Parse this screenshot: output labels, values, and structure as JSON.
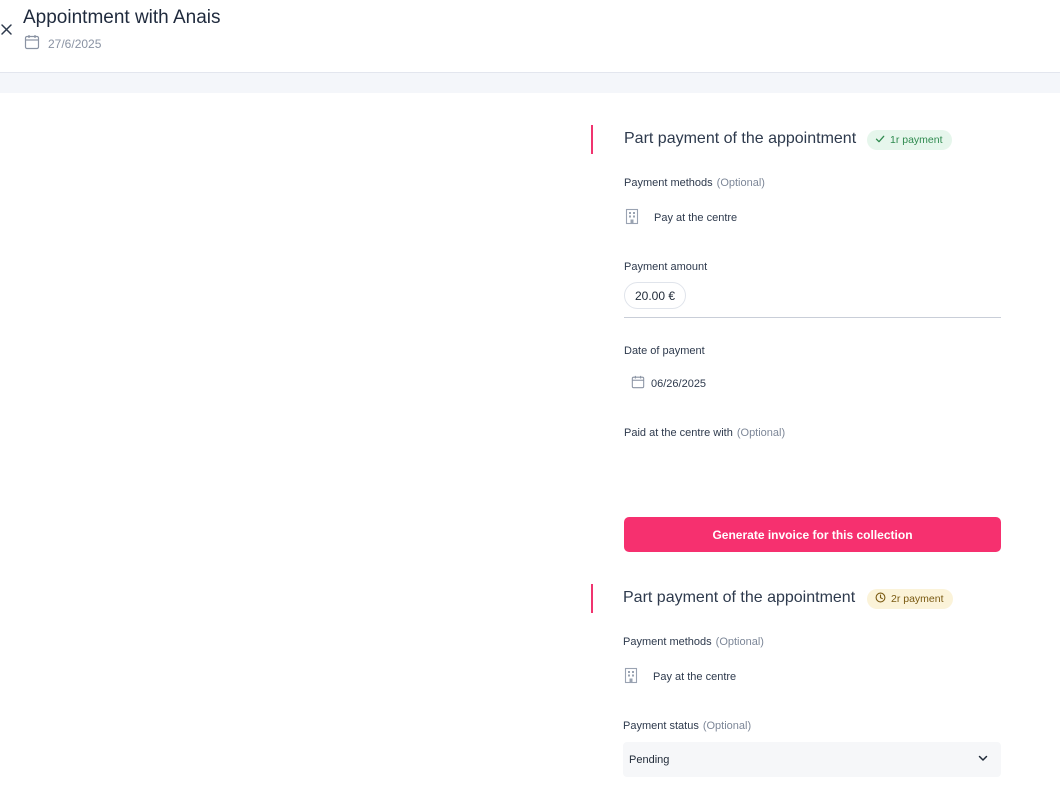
{
  "header": {
    "title": "Appointment with Anais",
    "date": "27/6/2025"
  },
  "payments": [
    {
      "title": "Part payment of the appointment",
      "badge": "1r payment",
      "badge_status": "paid",
      "methods_label": "Payment methods",
      "optional": "(Optional)",
      "method": "Pay at the centre",
      "amount_label": "Payment amount",
      "amount": "20.00 €",
      "date_label": "Date of payment",
      "date": "06/26/2025",
      "paid_with_label": "Paid at the centre with",
      "button_label": "Generate invoice for this collection"
    },
    {
      "title": "Part payment of the appointment",
      "badge": "2r payment",
      "badge_status": "pending",
      "methods_label": "Payment methods",
      "optional": "(Optional)",
      "method": "Pay at the centre",
      "status_label": "Payment status",
      "status_value": "Pending"
    }
  ],
  "colors": {
    "accent": "#f6306f",
    "paid_badge_bg": "#e6f6ec",
    "pending_badge_bg": "#fbf3d9"
  },
  "icons": [
    "close-icon",
    "calendar-icon",
    "check-icon",
    "clock-icon",
    "building-icon",
    "chevron-down-icon"
  ]
}
